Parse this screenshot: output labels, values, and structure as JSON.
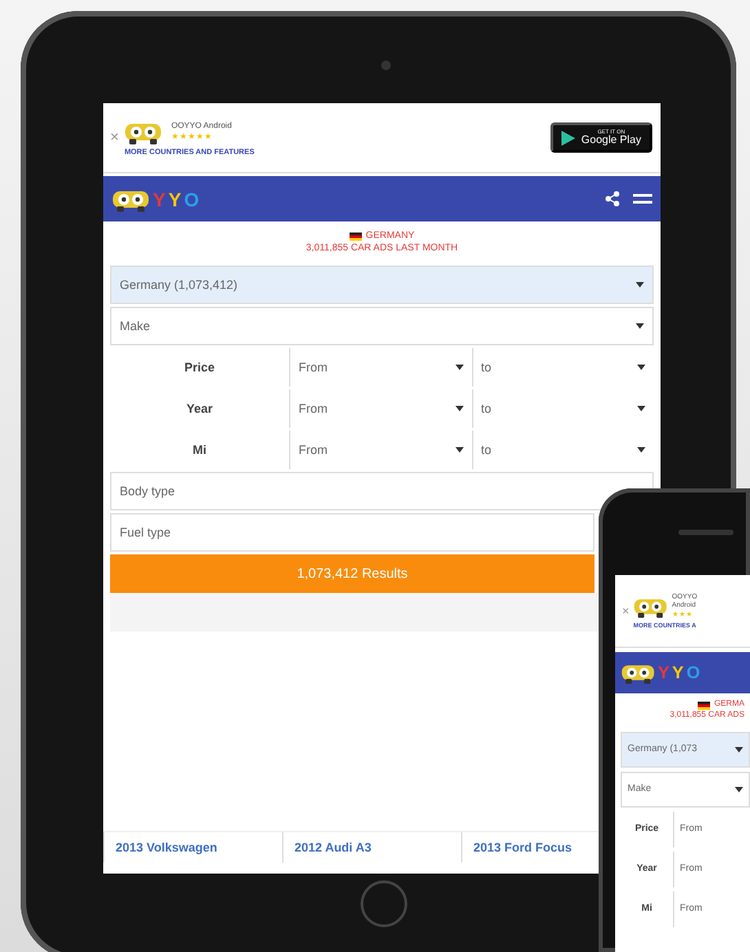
{
  "tablet": {
    "banner": {
      "close_icon": "×",
      "app_name": "OOYYO Android",
      "stars": 5,
      "promo": "MORE COUNTRIES AND FEATURES",
      "store_caption": "GET IT ON",
      "store_name": "Google Play"
    },
    "header": {
      "logo_letters": [
        "Y",
        "Y",
        "O"
      ]
    },
    "country": {
      "name": "GERMANY",
      "ads": "3,011,855 CAR ADS LAST MONTH"
    },
    "fields": [
      {
        "kind": "select",
        "value": "Germany (1,073,412)",
        "filled": true
      },
      {
        "kind": "select",
        "value": "Make",
        "filled": false
      },
      {
        "kind": "range",
        "label": "Price",
        "from": "From",
        "to": "to"
      },
      {
        "kind": "range",
        "label": "Year",
        "from": "From",
        "to": "to"
      },
      {
        "kind": "range",
        "label": "Mi",
        "from": "From",
        "to": "to"
      },
      {
        "kind": "text",
        "value": "Body type",
        "filled": false
      },
      {
        "kind": "text",
        "value": "Fuel type",
        "filled": false
      }
    ],
    "results_button": "1,073,412 Results",
    "listings": [
      "2013 Volkswagen",
      "2012 Audi A3",
      "2013 Ford Focus"
    ]
  },
  "phone": {
    "banner": {
      "close_icon": "×",
      "app_name": "OOYYO",
      "app_name_2": "Android",
      "stars": 3,
      "promo": "MORE COUNTRIES A"
    },
    "header": {
      "logo_letters": [
        "Y",
        "Y",
        "O"
      ]
    },
    "country": {
      "name": "GERMA",
      "ads": "3,011,855 CAR ADS"
    },
    "fields": [
      {
        "kind": "select",
        "value": "Germany (1,073",
        "filled": true
      },
      {
        "kind": "select",
        "value": "Make",
        "filled": false
      },
      {
        "kind": "range",
        "label": "Price",
        "from": "From"
      },
      {
        "kind": "range",
        "label": "Year",
        "from": "From"
      },
      {
        "kind": "range",
        "label": "Mi",
        "from": "From"
      }
    ]
  }
}
